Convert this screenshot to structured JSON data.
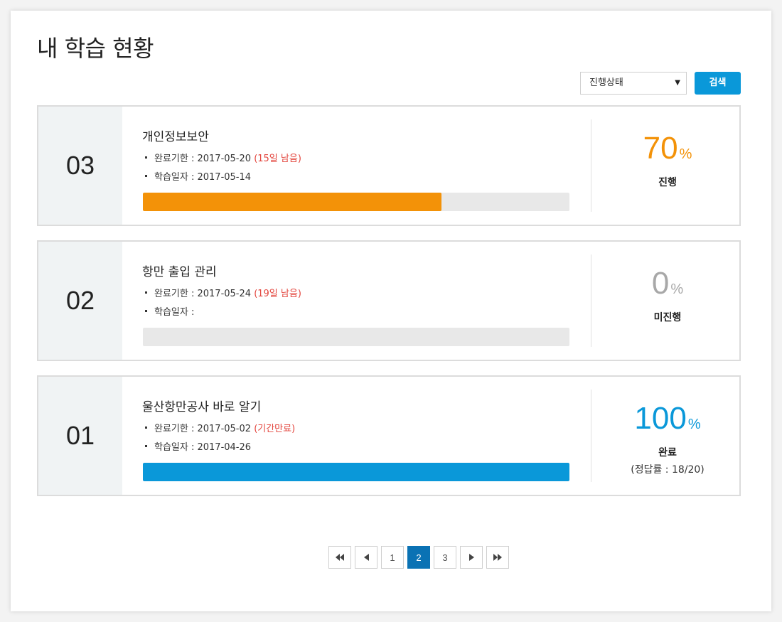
{
  "page": {
    "title": "내 학습 현황"
  },
  "filter": {
    "selected": "진행상태",
    "search_label": "검색"
  },
  "courses": [
    {
      "number": "03",
      "title": "개인정보보안",
      "deadline_label": "완료기한 : 2017-05-20",
      "deadline_note": "(15일 남음)",
      "study_label": "학습일자 : 2017-05-14",
      "progress": 70,
      "progress_color": "#f39208",
      "percent_value": "70",
      "percent_sign": "%",
      "percent_color": "#f39208",
      "status": "진행",
      "score": ""
    },
    {
      "number": "02",
      "title": "항만 출입 관리",
      "deadline_label": "완료기한 : 2017-05-24",
      "deadline_note": "(19일 남음)",
      "study_label": "학습일자 : ",
      "progress": 0,
      "progress_color": "#e8e8e8",
      "percent_value": "0",
      "percent_sign": "%",
      "percent_color": "#a8a8a8",
      "status": "미진행",
      "score": ""
    },
    {
      "number": "01",
      "title": "울산항만공사 바로 알기",
      "deadline_label": "완료기한 : 2017-05-02",
      "deadline_note": "(기간만료)",
      "study_label": "학습일자 : 2017-04-26",
      "progress": 100,
      "progress_color": "#0a98d9",
      "percent_value": "100",
      "percent_sign": "%",
      "percent_color": "#0a98d9",
      "status": "완료",
      "score": "(정답률 : 18/20)"
    }
  ],
  "pagination": {
    "first_icon": "double-chevron-left-icon",
    "prev_icon": "triangle-left-icon",
    "next_icon": "triangle-right-icon",
    "last_icon": "double-chevron-right-icon",
    "pages": [
      "1",
      "2",
      "3"
    ],
    "current": "2"
  }
}
